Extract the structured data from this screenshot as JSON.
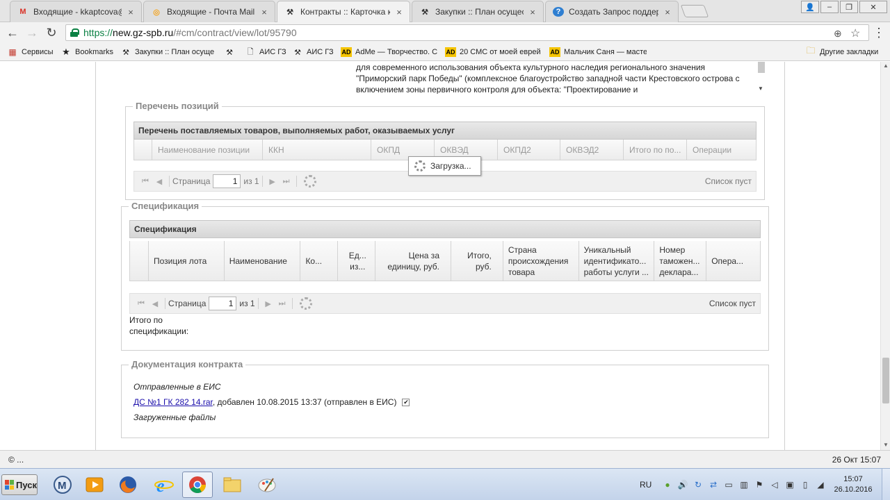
{
  "tabs": [
    {
      "title": "Входящие - kkaptcova@gn",
      "icon": "gmail-icon",
      "close": "×"
    },
    {
      "title": "Входящие - Почта Mail.Ru",
      "icon": "mailru-icon",
      "close": "×"
    },
    {
      "title": "Контракты :: Карточка ко",
      "icon": "hammer-icon",
      "close": "×"
    },
    {
      "title": "Закупки :: План осущест",
      "icon": "hammer-icon",
      "close": "×"
    },
    {
      "title": "Создать Запрос поддерж",
      "icon": "help-icon",
      "close": "×"
    }
  ],
  "window_controls": {
    "user": "👤",
    "minimize": "–",
    "restore": "❐",
    "close": "✕"
  },
  "omnibox": {
    "url_secure": "https://",
    "url_host": "new.gz-spb.ru",
    "url_path": "/#cm/contract/view/lot/95790",
    "back": "←",
    "forward": "→",
    "reload": "↻",
    "zoom_icon": "⊕",
    "star_icon": "☆",
    "menu_icon": "⋮"
  },
  "bookmarks": [
    {
      "label": "Сервисы",
      "icon": "apps-icon"
    },
    {
      "label": "Bookmarks",
      "icon": "star-icon"
    },
    {
      "label": "Закупки :: План осуще",
      "icon": "hammer-icon"
    },
    {
      "label": "",
      "icon": "hammer-icon"
    },
    {
      "label": "АИС ГЗ",
      "icon": "page-icon"
    },
    {
      "label": "АИС ГЗ",
      "icon": "hammer-icon"
    },
    {
      "label": "AdMe — Творчество. С",
      "icon": "adme-icon"
    },
    {
      "label": "20 СМС от моей еврей",
      "icon": "adme-icon"
    },
    {
      "label": "Мальчик Саня — масте",
      "icon": "adme-icon"
    }
  ],
  "other_bookmarks": "Другие закладки",
  "description": "для современного использования объекта культурного наследия регионального значения \"Приморский парк Победы\" (комплексное благоустройство западной части Крестовского острова с включением зоны первичного контроля для объекта: \"Проектирование и",
  "positions": {
    "legend": "Перечень позиций",
    "panel_title": "Перечень поставляемых товаров, выполняемых работ, оказываемых услуг",
    "columns": [
      "",
      "Наименование позиции",
      "ККН",
      "ОКПД",
      "ОКВЭД",
      "ОКПД2",
      "ОКВЭД2",
      "Итого по по...",
      "Операции"
    ],
    "loading": "Загрузка...",
    "pager": {
      "page_label": "Страница",
      "page": "1",
      "of": "из 1",
      "empty": "Список пуст"
    }
  },
  "specification": {
    "legend": "Спецификация",
    "panel_title": "Спецификация",
    "columns": [
      "",
      "Позиция лота",
      "Наименование",
      "Ко...",
      "Ед... из...",
      "Цена за единицу, руб.",
      "Итого, руб.",
      "Страна происхождения товара",
      "Уникальный идентификато... работы услуги ...",
      "Номер таможен... деклара...",
      "Опера..."
    ],
    "pager": {
      "page_label": "Страница",
      "page": "1",
      "of": "из 1",
      "empty": "Список пуст"
    },
    "total_label": "Итого по спецификации:"
  },
  "documents": {
    "legend": "Документация контракта",
    "sent_label": "Отправленные в ЕИС",
    "file_link": "ДС №1 ГК 282 14.rar",
    "file_info": ", добавлен 10.08.2015 13:37 (отправлен в ЕИС)",
    "file_checked": "✔",
    "uploaded_label": "Загруженные файлы"
  },
  "statusbar": {
    "left": "© ...",
    "right": "26 Окт 15:07"
  },
  "taskbar": {
    "start": "Пуск",
    "lang": "RU",
    "time": "15:07",
    "date": "26.10.2016"
  }
}
